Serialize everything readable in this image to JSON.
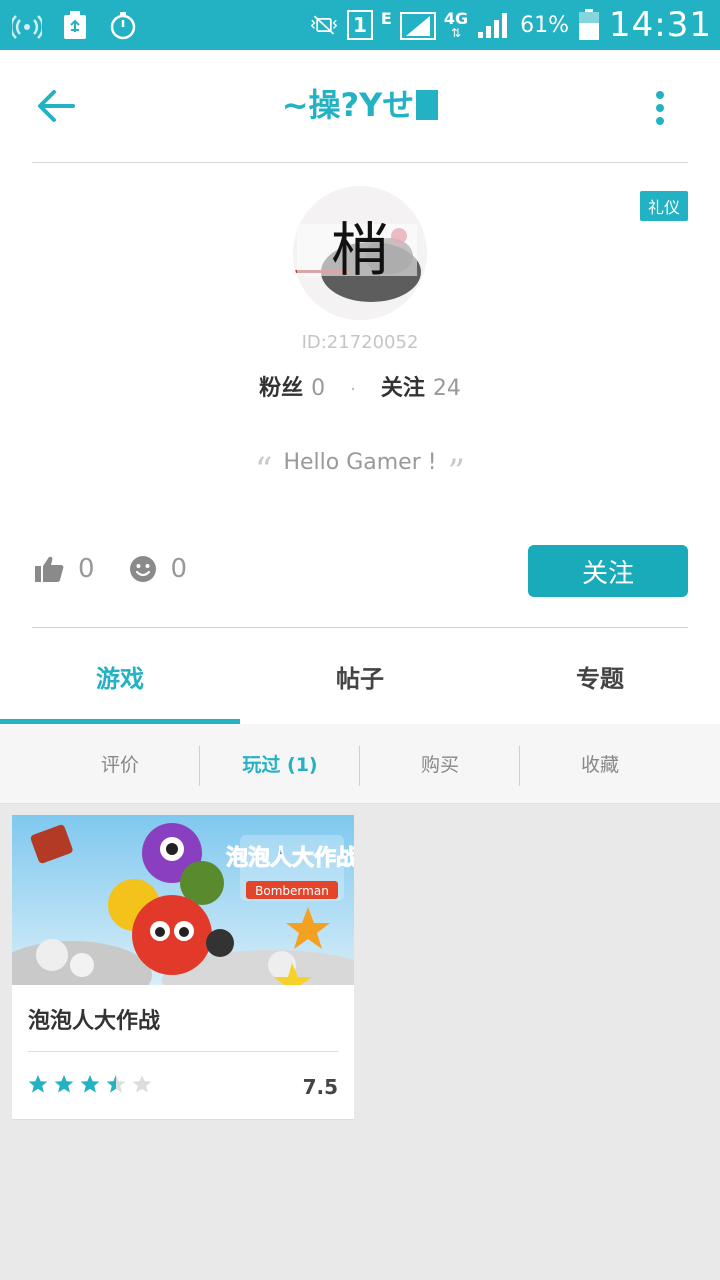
{
  "status_bar": {
    "sim_number": "1",
    "network_e": "E",
    "network_4g": "4G",
    "battery": "61%",
    "time": "14:31"
  },
  "header": {
    "title": "~操?Yせ",
    "back_icon": "arrow-left-icon",
    "more_icon": "more-vertical-icon"
  },
  "profile": {
    "badge": "礼仪",
    "avatar_text": "梢",
    "id_text": "ID:21720052",
    "fans_label": "粉丝",
    "fans_count": "0",
    "following_label": "关注",
    "following_count": "24",
    "dot": "·",
    "quote_open": "“",
    "signature": "Hello Gamer !",
    "quote_close": "”",
    "likes": "0",
    "smiles": "0",
    "follow_button": "关注"
  },
  "tabs": [
    {
      "label": "游戏",
      "active": true
    },
    {
      "label": "帖子",
      "active": false
    },
    {
      "label": "专题",
      "active": false
    }
  ],
  "subtabs": [
    {
      "label": "评价",
      "active": false
    },
    {
      "label": "玩过 (1)",
      "active": true
    },
    {
      "label": "购买",
      "active": false
    },
    {
      "label": "收藏",
      "active": false
    }
  ],
  "games": [
    {
      "name": "泡泡人大作战",
      "rating": "7.5",
      "stars": 3.5,
      "cover_logo_text": "泡泡人大作战",
      "cover_sub_text": "Bomberman"
    }
  ],
  "colors": {
    "accent": "#22b2c4",
    "follow_button": "#1aabbb",
    "star_empty": "#dddddd"
  }
}
